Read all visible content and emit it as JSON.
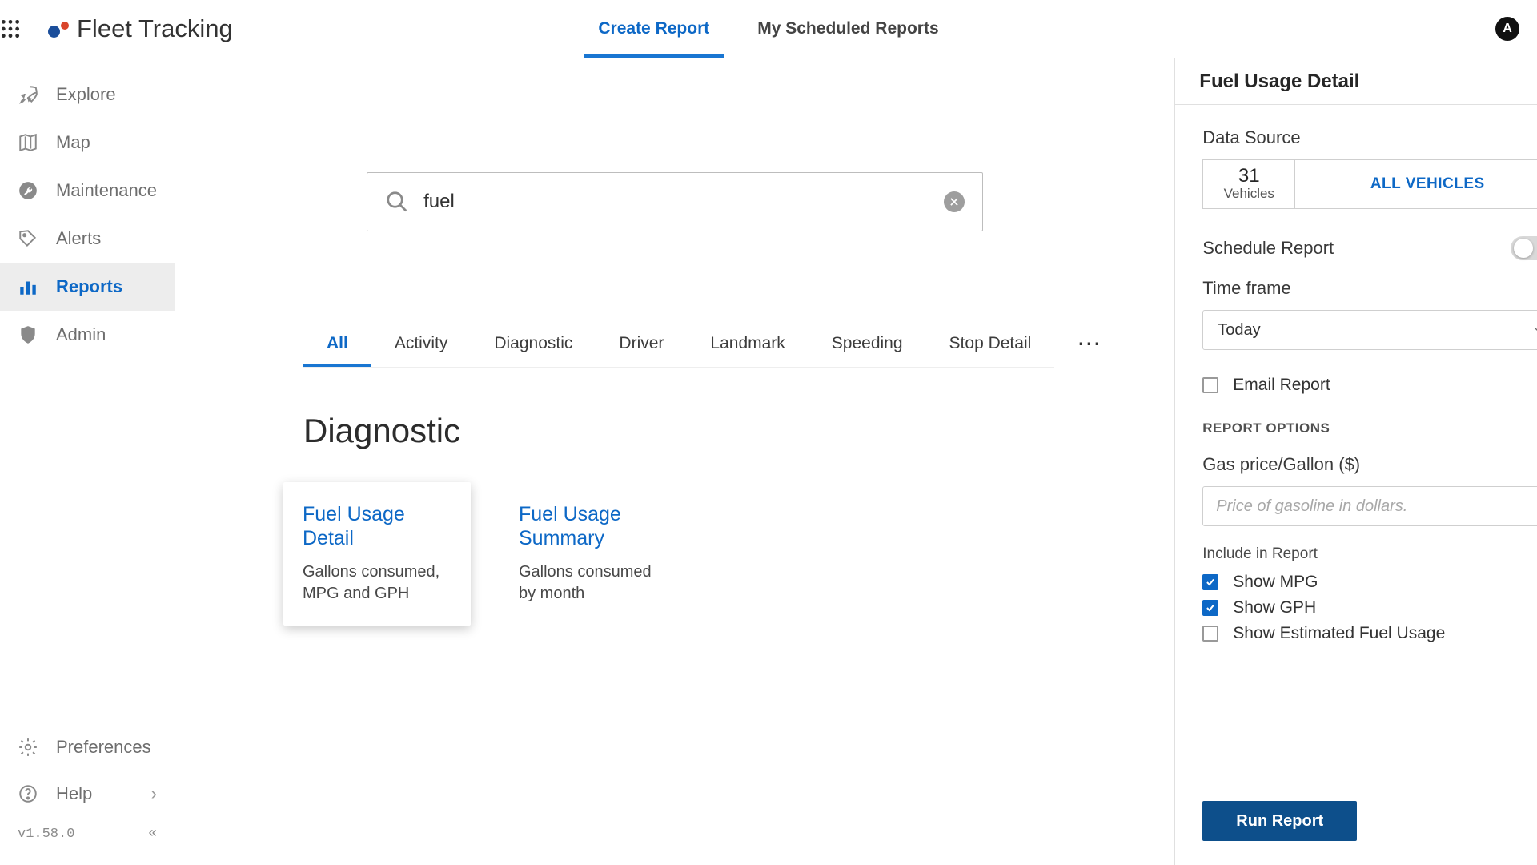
{
  "app_title": "Fleet Tracking",
  "top_tabs": {
    "create": "Create Report",
    "scheduled": "My Scheduled Reports"
  },
  "avatar_letter": "A",
  "sidebar": {
    "items": {
      "explore": "Explore",
      "map": "Map",
      "maintenance": "Maintenance",
      "alerts": "Alerts",
      "reports": "Reports",
      "admin": "Admin"
    },
    "bottom": {
      "preferences": "Preferences",
      "help": "Help"
    },
    "version": "v1.58.0"
  },
  "search_value": "fuel",
  "category_tabs": [
    "All",
    "Activity",
    "Diagnostic",
    "Driver",
    "Landmark",
    "Speeding",
    "Stop Detail"
  ],
  "section_title": "Diagnostic",
  "cards": [
    {
      "title": "Fuel Usage Detail",
      "desc": "Gallons consumed, MPG and GPH"
    },
    {
      "title": "Fuel Usage Summary",
      "desc": "Gallons consumed by month"
    }
  ],
  "panel": {
    "title": "Fuel Usage Detail",
    "data_source_label": "Data Source",
    "vehicle_count": "31",
    "vehicle_unit": "Vehicles",
    "all_vehicles": "ALL VEHICLES",
    "schedule_label": "Schedule Report",
    "timeframe_label": "Time frame",
    "timeframe_value": "Today",
    "email_label": "Email Report",
    "options_header": "REPORT OPTIONS",
    "gas_label": "Gas price/Gallon ($)",
    "gas_placeholder": "Price of gasoline in dollars.",
    "include_label": "Include in Report",
    "show_mpg": "Show MPG",
    "show_gph": "Show GPH",
    "show_est": "Show Estimated Fuel Usage",
    "run": "Run Report"
  }
}
